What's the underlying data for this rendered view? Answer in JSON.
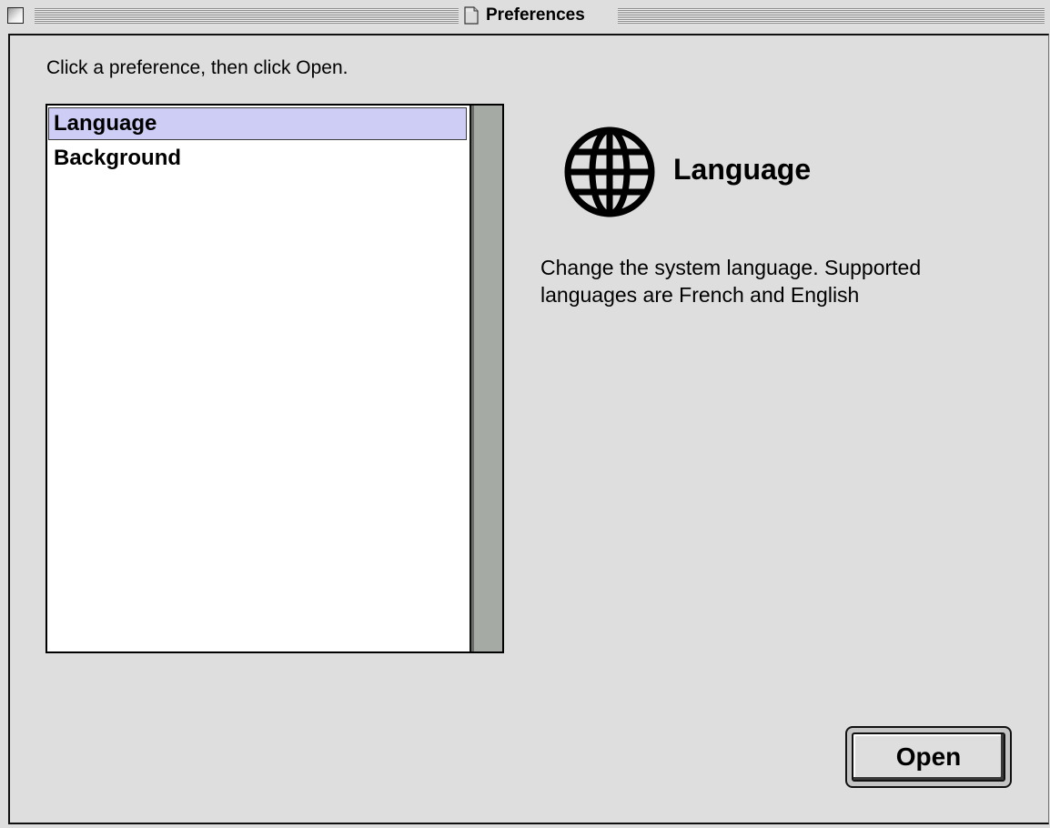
{
  "window": {
    "title": "Preferences"
  },
  "instruction": "Click a preference, then click Open.",
  "preferences": {
    "items": [
      {
        "label": "Language",
        "selected": true
      },
      {
        "label": "Background",
        "selected": false
      }
    ]
  },
  "detail": {
    "icon": "globe-icon",
    "title": "Language",
    "description": "Change the system language. Supported languages are French and English"
  },
  "buttons": {
    "open_label": "Open"
  },
  "colors": {
    "selection": "#cdcdf6",
    "scrollbar": "#a6aaa5",
    "window_background": "#dedede"
  }
}
